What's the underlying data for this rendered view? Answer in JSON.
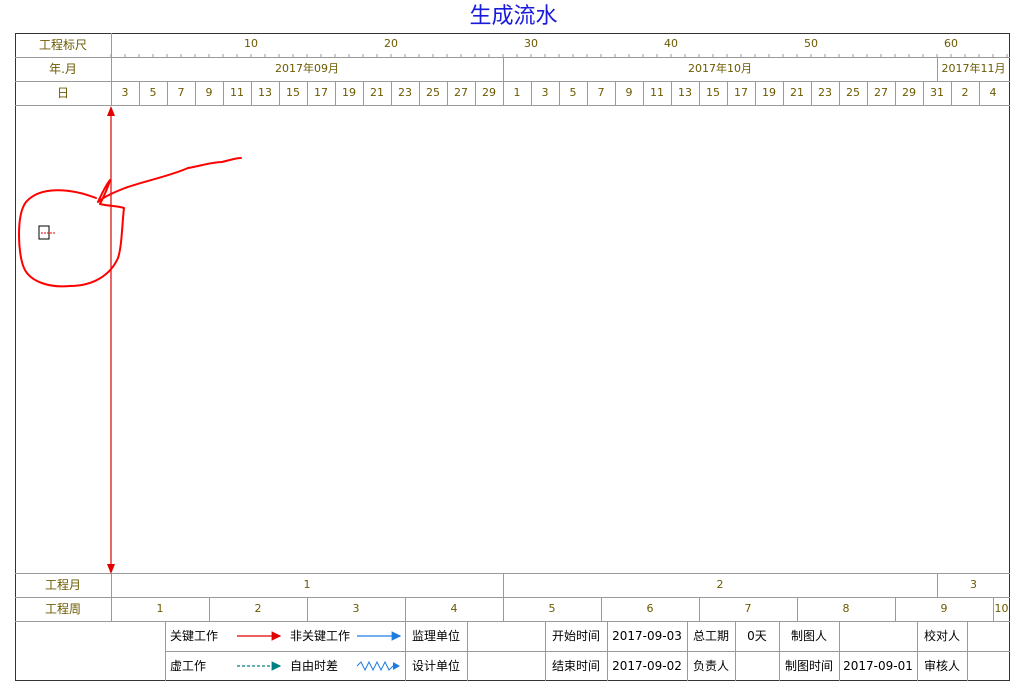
{
  "title": "生成流水",
  "rows": {
    "scale_label": "工程标尺",
    "month_label": "年.月",
    "day_label": "日",
    "proj_month_label": "工程月",
    "proj_week_label": "工程周"
  },
  "scale_ticks": [
    "10",
    "20",
    "30",
    "40",
    "50",
    "60"
  ],
  "months": [
    "2017年09月",
    "2017年10月",
    "2017年11月"
  ],
  "days": [
    "3",
    "5",
    "7",
    "9",
    "11",
    "13",
    "15",
    "17",
    "19",
    "21",
    "23",
    "25",
    "27",
    "29",
    "1",
    "3",
    "5",
    "7",
    "9",
    "11",
    "13",
    "15",
    "17",
    "19",
    "21",
    "23",
    "25",
    "27",
    "29",
    "31",
    "2",
    "4"
  ],
  "proj_months": [
    "1",
    "2",
    "3"
  ],
  "proj_weeks": [
    "1",
    "2",
    "3",
    "4",
    "5",
    "6",
    "7",
    "8",
    "9",
    "10"
  ],
  "legend": {
    "critical": "关键工作",
    "noncritical": "非关键工作",
    "dummy": "虚工作",
    "free_float": "自由时差"
  },
  "info": {
    "supervisor_label": "监理单位",
    "design_label": "设计单位",
    "start_label": "开始时间",
    "start_value": "2017-09-03",
    "end_label": "结束时间",
    "end_value": "2017-09-02",
    "duration_label": "总工期",
    "duration_value": "0天",
    "manager_label": "负责人",
    "drawer_label": "制图人",
    "draw_time_label": "制图时间",
    "draw_time_value": "2017-09-01",
    "checker_label": "校对人",
    "auditor_label": "审核人"
  },
  "colors": {
    "title": "#1a1adc",
    "critical": "#e00000",
    "noncritical": "#1e7ce0",
    "dummy": "#008080",
    "annotation": "#ff0000",
    "label_text": "#6b5a00"
  }
}
